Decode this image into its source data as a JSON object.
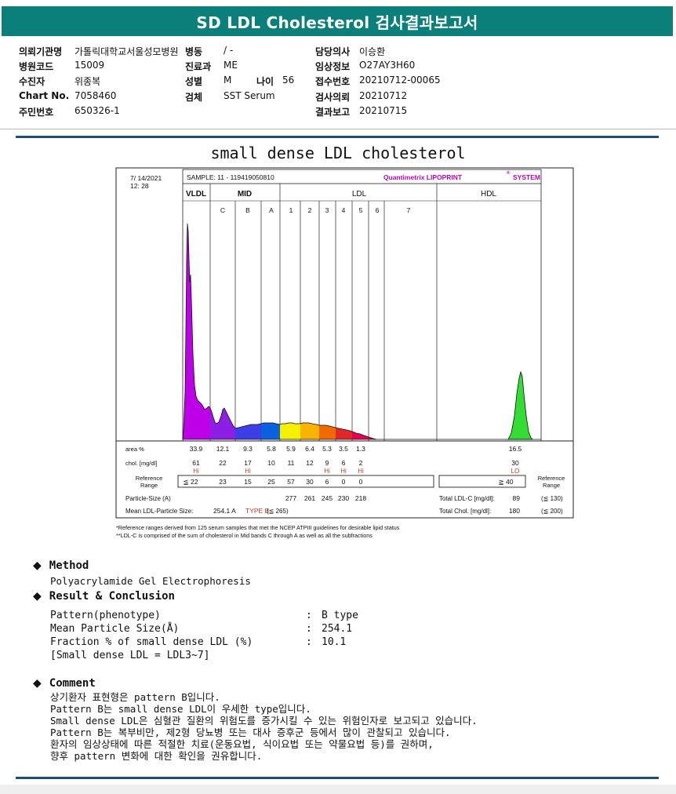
{
  "header": {
    "title": "SD LDL Cholesterol 검사결과보고서"
  },
  "patient_info": {
    "rows": [
      [
        {
          "label": "의뢰기관명",
          "value": "가톨릭대학교서울성모병원"
        },
        {
          "label": "병동",
          "value": "/ -"
        },
        {
          "label": "담당의사",
          "value": "이승환"
        }
      ],
      [
        {
          "label": "병원코드",
          "value": "15009"
        },
        {
          "label": "진료과",
          "value": "ME"
        },
        {
          "label": "임상정보",
          "value": "O27AY3H60"
        }
      ],
      [
        {
          "label": "수진자",
          "value": "위종복"
        },
        {
          "label": "성별",
          "value": "M"
        },
        {
          "label": "접수번호",
          "value": "20210712-00065"
        }
      ],
      [
        {
          "label": "Chart No.",
          "value": "7058460"
        },
        {
          "label": "검체",
          "value": "SST Serum"
        },
        {
          "label": "검사의뢰",
          "value": "20210712"
        }
      ],
      [
        {
          "label": "주민번호",
          "value": "650326-1"
        },
        null,
        {
          "label": "결과보고",
          "value": "20210715"
        }
      ]
    ],
    "age": {
      "label": "나이",
      "value": "56"
    }
  },
  "report_title": "small dense LDL cholesterol",
  "lipoprint": {
    "date": "7/ 14/2021",
    "time": "12: 28",
    "sample": "SAMPLE:   11 - 119419050810",
    "brand": "Quantimetrix LIPOPRINT",
    "brand_sup": "®",
    "brand_tail": "SYSTEM",
    "groups": [
      "VLDL",
      "MID",
      "LDL",
      "HDL"
    ],
    "bands": [
      "C",
      "B",
      "A",
      "1",
      "2",
      "3",
      "4",
      "5",
      "6",
      "7"
    ],
    "row_labels": {
      "area": "area %",
      "chol": "chol. [mg/dl]",
      "ref_line1": "Reference",
      "ref_line2": "Range",
      "ref_right1": "Reference",
      "ref_right2": "Range",
      "particle": "Particle-Size (A)",
      "mean": "Mean LDL-Particle Size:"
    },
    "area_values": [
      "33.9",
      "12.1",
      "9.3",
      "5.8",
      "5.9",
      "6.4",
      "5.3",
      "3.5",
      "1.3",
      "16.5"
    ],
    "chol_values": [
      "61",
      "22",
      "17",
      "10",
      "11",
      "12",
      "9",
      "6",
      "2",
      "30"
    ],
    "flags": [
      "Hi",
      "",
      "Hi",
      "",
      "",
      "",
      "Hi",
      "Hi",
      "Hi",
      "LO"
    ],
    "ref_values": [
      "≦ 22",
      "23",
      "15",
      "25",
      "57",
      "30",
      "6",
      "0",
      "0",
      "≧ 40"
    ],
    "particle_sizes": [
      "277",
      "261",
      "245",
      "230",
      "218"
    ],
    "mean_ldl": "254.1 A",
    "mean_type": "TYPE B",
    "mean_ref": "(≦ 265)",
    "total_ldl_label": "Total LDL-C [mg/dl]:",
    "total_ldl": "89",
    "total_ldl_ref": "(≦ 130)",
    "total_chol_label": "Total Chol. [mg/dl]:",
    "total_chol": "180",
    "total_chol_ref": "(≦ 200)",
    "footnote1": "*Reference ranges derived from 125 serum samples that met the NCEP ATPIII guidelines for desirable lipid status",
    "footnote2": "**LDL-C is comprised of the sum of cholesterol in Mid bands C through A as well as all the subfractions"
  },
  "chart_data": {
    "type": "area",
    "title": "small dense LDL cholesterol",
    "categories": [
      "VLDL",
      "C",
      "B",
      "A",
      "1",
      "2",
      "3",
      "4",
      "5",
      "6",
      "7",
      "HDL"
    ],
    "series": [
      {
        "name": "area %",
        "values": [
          33.9,
          12.1,
          9.3,
          5.8,
          5.9,
          6.4,
          5.3,
          3.5,
          1.3,
          null,
          null,
          16.5
        ]
      },
      {
        "name": "chol. [mg/dl]",
        "values": [
          61,
          22,
          17,
          10,
          11,
          12,
          9,
          6,
          2,
          null,
          null,
          30
        ]
      }
    ]
  },
  "method": {
    "heading": "Method",
    "text": "Polyacrylamide Gel Electrophoresis"
  },
  "result": {
    "heading": "Result & Conclusion",
    "rows": [
      {
        "label": "Pattern(phenotype)",
        "value": "B type"
      },
      {
        "label": "Mean Particle Size(Å)",
        "value": "254.1"
      },
      {
        "label": "Fraction % of small dense LDL (%)",
        "value": "10.1"
      }
    ],
    "note": "[Small dense LDL = LDL3~7]"
  },
  "comment": {
    "heading": "Comment",
    "lines": [
      "상기환자 표현형은 pattern B입니다.",
      "Pattern B는 small dense LDL이 우세한 type입니다.",
      "Small dense LDL은 심혈관 질환의 위험도를 증가시킬 수 있는 위험인자로 보고되고 있습니다.",
      "Pattern B는 복부비만, 제2형 당뇨병 또는 대사 증후군 등에서 많이 관찰되고 있습니다.",
      "환자의 임상상태에 따른 적절한 치료(운동요법, 식이요법 또는 약물요법 등)를 권하며,",
      "향후 pattern 변화에 대한 확인을 권유합니다."
    ]
  },
  "colors": {
    "header": "#0b7f7a",
    "rule": "#1d4f78",
    "flag": "#c0392b",
    "brand": "#c000c0"
  }
}
